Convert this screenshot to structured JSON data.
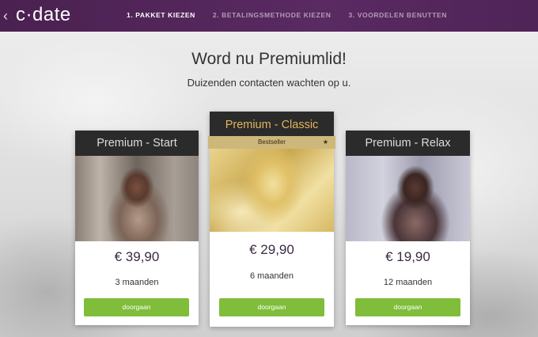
{
  "header": {
    "logo": "c·date",
    "back_icon": "chevron-left-icon",
    "steps": [
      {
        "label": "1. PAKKET KIEZEN",
        "active": true
      },
      {
        "label": "2. BETALINGSMETHODE KIEZEN",
        "active": false
      },
      {
        "label": "3. VOORDELEN BENUTTEN",
        "active": false
      }
    ]
  },
  "main": {
    "title": "Word nu Premiumlid!",
    "subtitle": "Duizenden contacten wachten op u."
  },
  "plans": [
    {
      "name": "Premium - Start",
      "price": "€ 39,90",
      "term": "3 maanden",
      "button": "doorgaan"
    },
    {
      "name": "Premium - Classic",
      "badge": "Bestseller",
      "badge_icon": "star-icon",
      "price": "€ 29,90",
      "term": "6 maanden",
      "button": "doorgaan"
    },
    {
      "name": "Premium - Relax",
      "price": "€ 19,90",
      "term": "12 maanden",
      "button": "doorgaan"
    }
  ],
  "colors": {
    "header_bg": "#4a2150",
    "button_green": "#7fbd3a",
    "card_head": "#2b2b2b",
    "featured_title": "#e3b55a",
    "bestseller_band": "#cdb77b"
  }
}
